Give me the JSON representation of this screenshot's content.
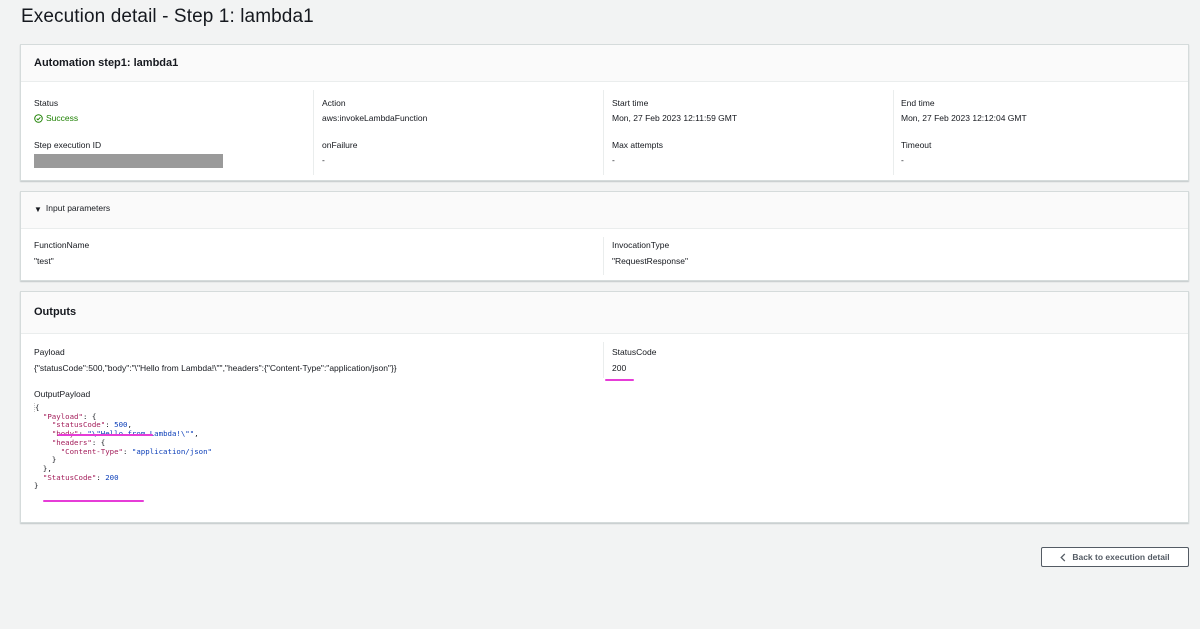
{
  "page": {
    "title": "Execution detail - Step 1: lambda1"
  },
  "step_panel": {
    "title": "Automation step1: lambda1",
    "status_label": "Status",
    "status_value": "Success",
    "action_label": "Action",
    "action_value": "aws:invokeLambdaFunction",
    "start_label": "Start time",
    "start_value": "Mon, 27 Feb 2023 12:11:59 GMT",
    "end_label": "End time",
    "end_value": "Mon, 27 Feb 2023 12:12:04 GMT",
    "step_id_label": "Step execution ID",
    "onfailure_label": "onFailure",
    "onfailure_value": "-",
    "max_attempts_label": "Max attempts",
    "max_attempts_value": "-",
    "timeout_label": "Timeout",
    "timeout_value": "-"
  },
  "input_panel": {
    "title": "Input parameters",
    "function_name_label": "FunctionName",
    "function_name_value": "\"test\"",
    "invocation_type_label": "InvocationType",
    "invocation_type_value": "\"RequestResponse\""
  },
  "outputs_panel": {
    "title": "Outputs",
    "payload_label": "Payload",
    "payload_value": "{\"statusCode\":500,\"body\":\"\\\"Hello from Lambda!\\\"\",\"headers\":{\"Content-Type\":\"application/json\"}}",
    "status_code_label": "StatusCode",
    "status_code_value": "200",
    "output_payload_label": "OutputPayload",
    "code": {
      "open": "{",
      "payload_key": "\"Payload\"",
      "statuscode_key": "\"statusCode\"",
      "statuscode_val": "500",
      "body_key": "\"body\"",
      "body_val": "\"\\\"Hello from Lambda!\\\"\"",
      "headers_key": "\"headers\"",
      "ctype_key": "\"Content-Type\"",
      "ctype_val": "\"application/json\"",
      "outer_statuscode_key": "\"StatusCode\"",
      "outer_statuscode_val": "200",
      "close": "}"
    }
  },
  "footer": {
    "back_button_label": "Back to execution detail"
  },
  "colors": {
    "success": "#1d8102",
    "highlight": "#e63cd7",
    "json_key": "#a31d5a",
    "json_value": "#0a3db8"
  }
}
